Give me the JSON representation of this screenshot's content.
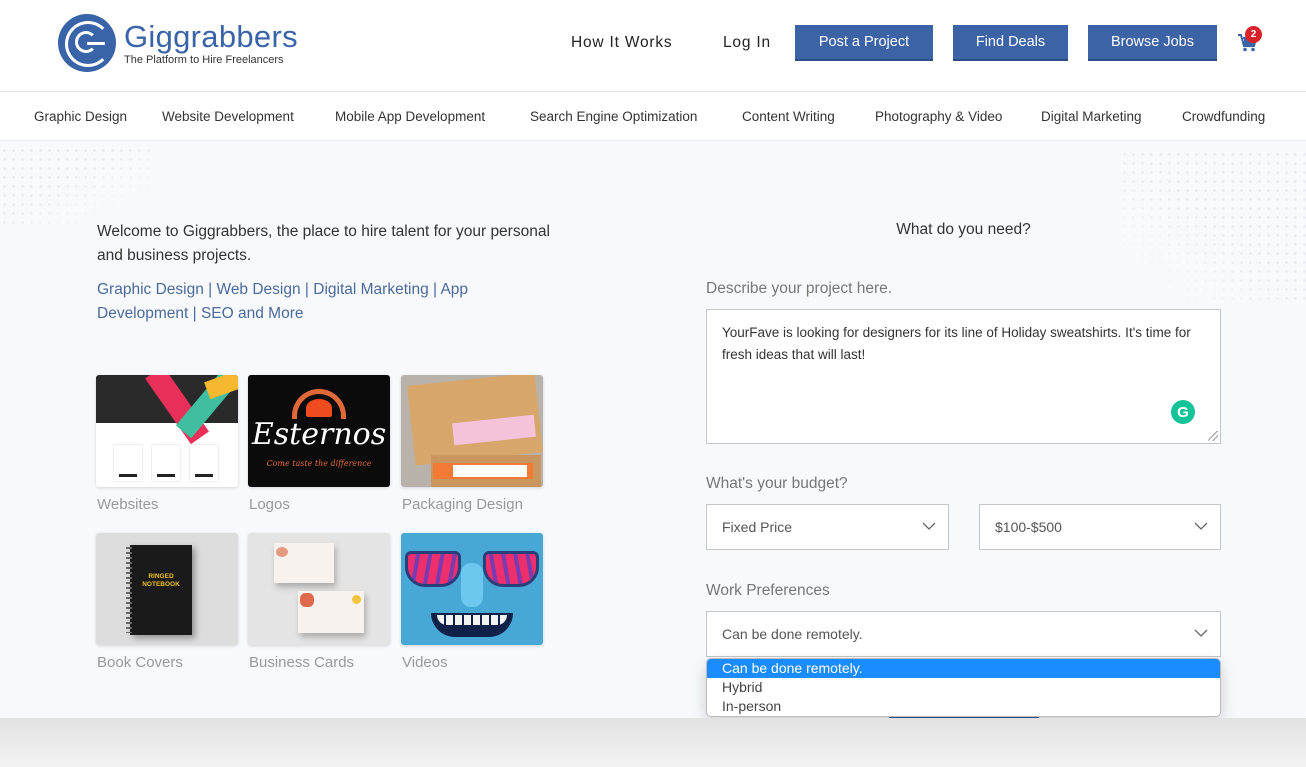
{
  "header": {
    "logo": {
      "name": "Giggrabbers",
      "tagline": "The Platform to Hire Freelancers"
    },
    "nav_links": [
      {
        "label": "How It Works"
      },
      {
        "label": "Log In"
      }
    ],
    "nav_buttons": [
      {
        "label": "Post a Project"
      },
      {
        "label": "Find Deals"
      },
      {
        "label": "Browse Jobs"
      }
    ],
    "cart": {
      "icon": "cart-icon",
      "count": "2"
    }
  },
  "categories": [
    "Graphic Design",
    "Website Development",
    "Mobile App Development",
    "Search Engine Optimization",
    "Content Writing",
    "Photography & Video",
    "Digital Marketing",
    "Crowdfunding"
  ],
  "intro": {
    "welcome": "Welcome to Giggrabbers, the place to hire talent for your personal and business projects.",
    "services": "Graphic Design | Web Design | Digital Marketing | App Development | SEO and More"
  },
  "gallery": [
    {
      "label": "Websites"
    },
    {
      "label": "Logos",
      "image_text": "Esternos",
      "image_subtext": "Come taste the difference"
    },
    {
      "label": "Packaging Design"
    },
    {
      "label": "Book Covers",
      "image_text": "RINGED NOTEBOOK"
    },
    {
      "label": "Business Cards"
    },
    {
      "label": "Videos"
    }
  ],
  "form": {
    "title": "What do you need?",
    "description_label": "Describe your project here.",
    "description_value": "YourFave is looking for designers for its line of Holiday sweatshirts. It's time for fresh ideas that will last!",
    "budget_label": "What's your budget?",
    "budget_type": "Fixed Price",
    "budget_range": "$100-$500",
    "work_pref_label": "Work Preferences",
    "work_pref_value": "Can be done remotely.",
    "work_pref_options": [
      "Can be done remotely.",
      "Hybrid",
      "In-person"
    ],
    "work_pref_selected_index": 0
  },
  "colors": {
    "brand_blue": "#3c63a6",
    "highlight": "#1a8cff",
    "badge_red": "#d9232a",
    "grammarly_green": "#15c39a"
  }
}
